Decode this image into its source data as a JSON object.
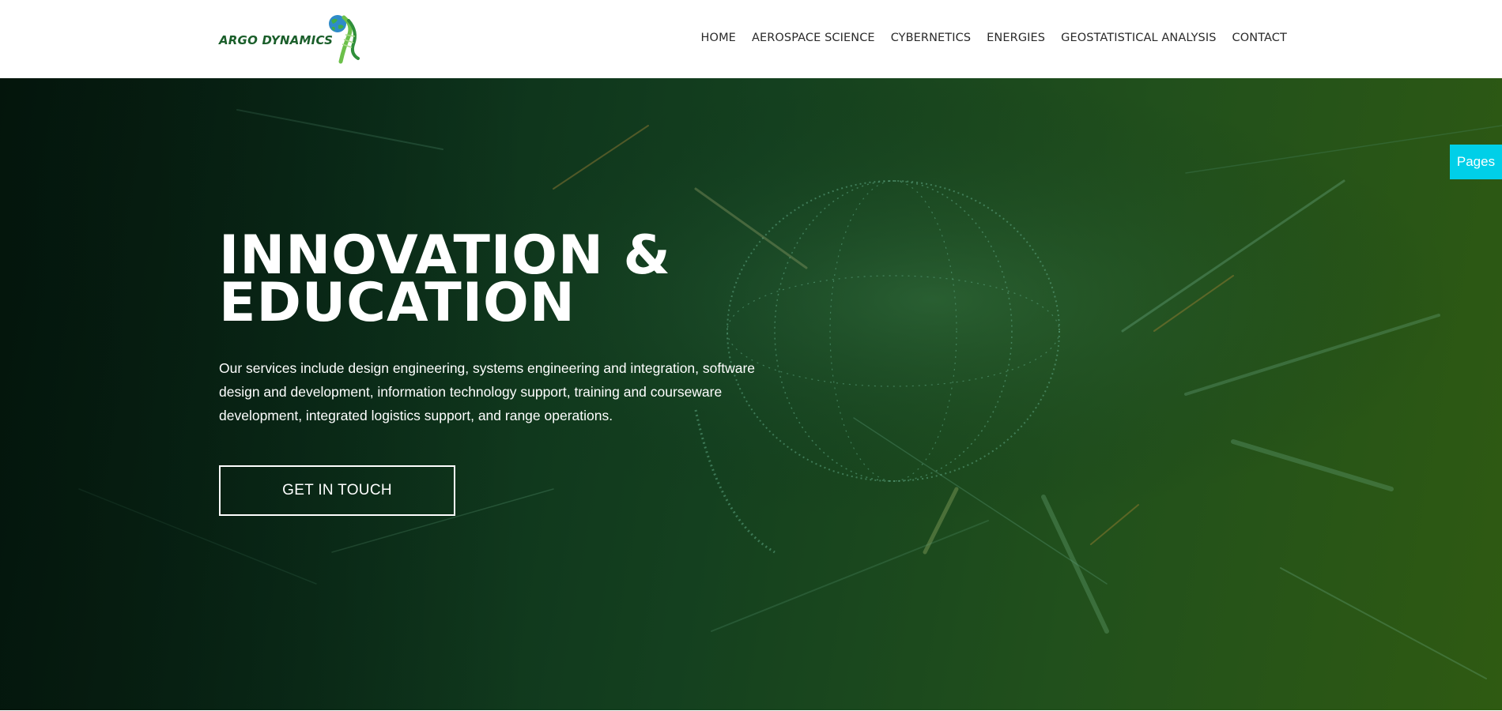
{
  "header": {
    "logo_text": "ARGO DYNAMICS",
    "nav": [
      {
        "label": "HOME"
      },
      {
        "label": "AEROSPACE SCIENCE"
      },
      {
        "label": "CYBERNETICS"
      },
      {
        "label": "ENERGIES"
      },
      {
        "label": "GEOSTATISTICAL ANALYSIS"
      },
      {
        "label": "CONTACT"
      }
    ]
  },
  "hero": {
    "title_line1": "INNOVATION &",
    "title_line2": "EDUCATION",
    "description": "Our services include design engineering, systems engineering and integration, software design and development, information technology support, training and courseware development, integrated logistics support, and range operations.",
    "cta_label": "GET IN TOUCH"
  },
  "side_tab": {
    "label": "Pages"
  },
  "colors": {
    "brand_green": "#1a5e2a",
    "pages_tab": "#00cfe8",
    "hero_dark": "#061f12",
    "hero_light": "#2f5a12"
  },
  "icons": {
    "logo_mark": "globe-swoosh-icon"
  }
}
